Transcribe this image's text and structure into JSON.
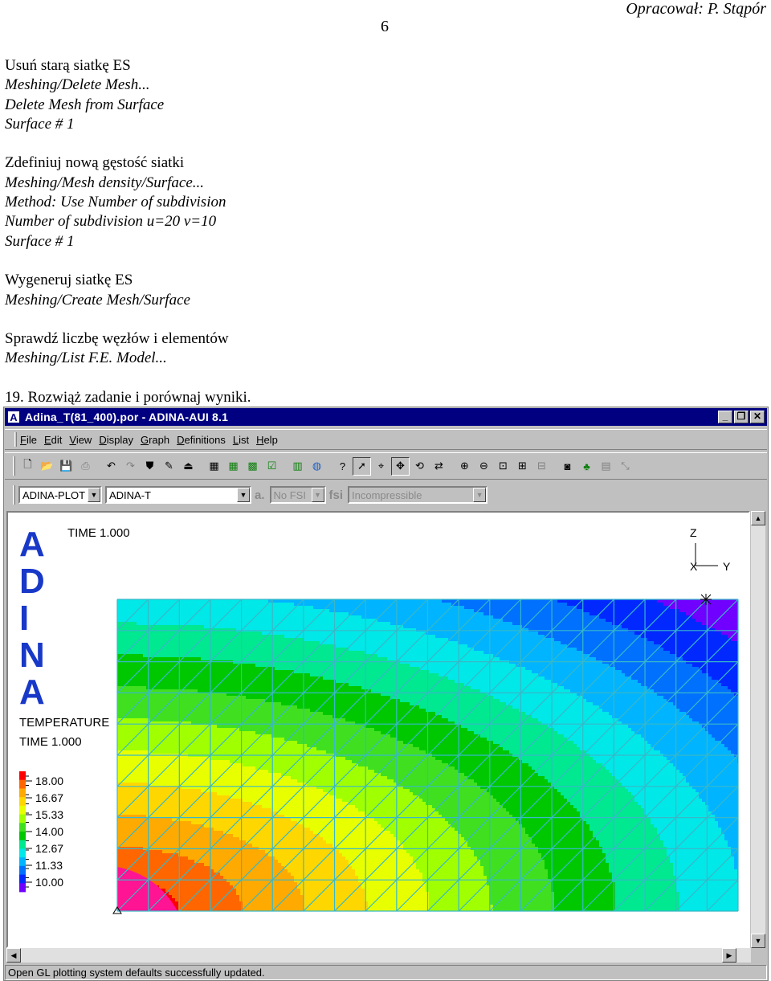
{
  "page": {
    "number": "6",
    "author": "Opracował:  P. Stąpór"
  },
  "doc_lines": [
    {
      "text": "Usuń starą siatkę ES",
      "style": "normal"
    },
    {
      "text": "Meshing/Delete Mesh...",
      "style": "italic"
    },
    {
      "text": "Delete Mesh from Surface",
      "style": "italic"
    },
    {
      "text": "Surface # 1",
      "style": "italic"
    },
    {
      "text": "",
      "style": "gap"
    },
    {
      "text": "Zdefiniuj nową gęstość siatki",
      "style": "normal"
    },
    {
      "text": "Meshing/Mesh density/Surface...",
      "style": "italic"
    },
    {
      "text": "Method: Use Number of subdivision",
      "style": "italic"
    },
    {
      "text": "Number of subdivision u=20 v=10",
      "style": "italic"
    },
    {
      "text": "Surface # 1",
      "style": "italic"
    },
    {
      "text": "",
      "style": "gap"
    },
    {
      "text": "Wygeneruj siatkę ES",
      "style": "normal"
    },
    {
      "text": "Meshing/Create Mesh/Surface",
      "style": "italic"
    },
    {
      "text": "",
      "style": "gap"
    },
    {
      "text": "Sprawdź liczbę węzłów i elementów",
      "style": "normal"
    },
    {
      "text": "Meshing/List F.E. Model...",
      "style": "italic"
    },
    {
      "text": "",
      "style": "gap"
    },
    {
      "text": "19. Rozwiąż zadanie i porównaj wyniki.",
      "style": "normal"
    }
  ],
  "window": {
    "title": "Adina_T(81_400).por - ADINA-AUI  8.1",
    "app_icon": "A",
    "controls": [
      "_",
      "❐",
      "✕"
    ],
    "menu": [
      "File",
      "Edit",
      "View",
      "Display",
      "Graph",
      "Definitions",
      "List",
      "Help"
    ],
    "toolbar_icons": [
      "new-file-icon",
      "open-folder-icon",
      "save-icon",
      "print-icon",
      "sep",
      "undo-icon",
      "redo-icon",
      "clear-icon",
      "pencil-icon",
      "stamp-icon",
      "sep",
      "clear-screen-icon",
      "mesh-grid-icon",
      "mesh-plot-icon",
      "mesh-check-icon",
      "sep",
      "bar-chart-icon",
      "globe-icon",
      "sep",
      "help-icon",
      "pick-arrow-icon",
      "query-icon",
      "move-icon",
      "rotate-icon",
      "mirror-icon",
      "sep",
      "zoom-in-icon",
      "zoom-out-icon",
      "zoom-window-icon",
      "fit-icon",
      "unfit-icon",
      "sep",
      "camera-icon",
      "tree-icon",
      "ruler-icon",
      "scale-icon"
    ],
    "program_select": "ADINA-PLOT",
    "module_select": "ADINA-T",
    "fsi_select": "No FSI",
    "flow_select": "Incompressible",
    "status": "Open GL plotting system defaults successfully updated."
  },
  "plot": {
    "logo_letters": [
      "A",
      "D",
      "I",
      "N",
      "A"
    ],
    "time_label": "TIME 1.000",
    "legend_title": "TEMPERATURE",
    "legend_time": "TIME 1.000",
    "axis_z": "Z",
    "axis_x": "X",
    "axis_y": "Y",
    "legend_values": [
      "18.00",
      "16.67",
      "15.33",
      "14.00",
      "12.67",
      "11.33",
      "10.00"
    ],
    "legend_colors": [
      "#ff0000",
      "#ff6600",
      "#ffaa00",
      "#ffd700",
      "#e8ff00",
      "#a0ff00",
      "#40e020",
      "#00c800",
      "#00e890",
      "#00e8e8",
      "#00b4ff",
      "#0070ff",
      "#0028ff",
      "#7000ff"
    ]
  },
  "chart_data": {
    "type": "heatmap",
    "title": "TEMPERATURE",
    "time": "TIME 1.000",
    "min": 10.0,
    "max": 18.0,
    "levels": [
      "18.00",
      "16.67",
      "15.33",
      "14.00",
      "12.67",
      "11.33",
      "10.00"
    ],
    "mesh": {
      "u_subdivisions": 20,
      "v_subdivisions": 10,
      "element": "triangle"
    },
    "description_of_field": "temperature highest at lower-left corner, decreasing radially towards upper-right corner"
  }
}
